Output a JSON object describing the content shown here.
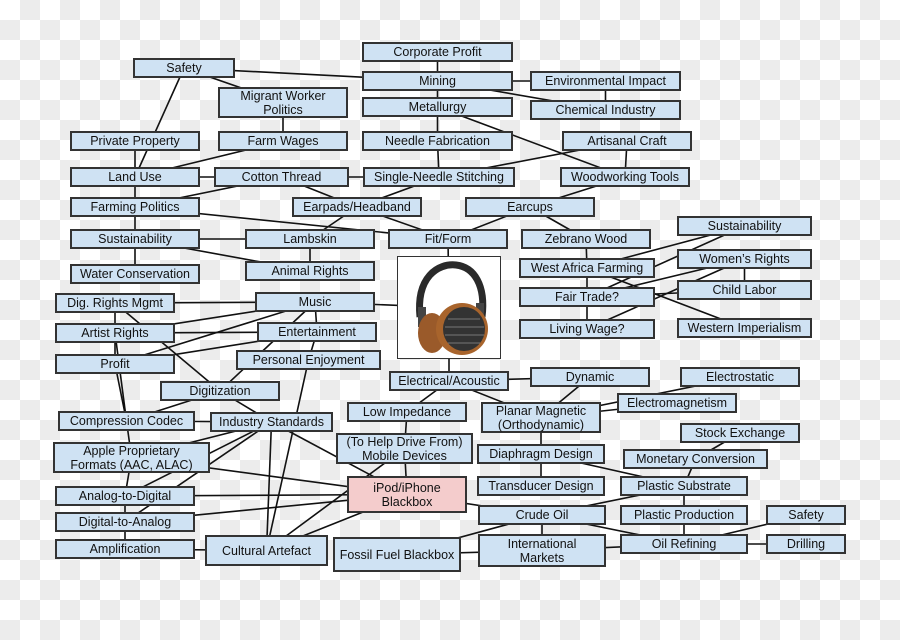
{
  "nodes": {
    "corp_profit": "Corporate Profit",
    "safety1": "Safety",
    "mining": "Mining",
    "env_impact": "Environmental Impact",
    "migrant": "Migrant Worker\nPolitics",
    "metallurgy": "Metallurgy",
    "chemical": "Chemical Industry",
    "private_prop": "Private Property",
    "farm_wages": "Farm Wages",
    "needle_fab": "Needle Fabrication",
    "artisanal": "Artisanal Craft",
    "land_use": "Land Use",
    "cotton": "Cotton Thread",
    "single_needle": "Single-Needle Stitching",
    "woodworking": "Woodworking Tools",
    "farming_pol": "Farming Politics",
    "earpads": "Earpads/Headband",
    "earcups": "Earcups",
    "sustain1": "Sustainability",
    "lambskin": "Lambskin",
    "fitform": "Fit/Form",
    "zebrano": "Zebrano Wood",
    "sustain2": "Sustainability",
    "water": "Water Conservation",
    "animal": "Animal Rights",
    "west_africa": "West Africa Farming",
    "womens": "Women’s Rights",
    "fair_trade": "Fair Trade?",
    "child_labor": "Child Labor",
    "drm": "Dig. Rights Mgmt",
    "music": "Music",
    "artist": "Artist Rights",
    "entertain": "Entertainment",
    "living_wage": "Living Wage?",
    "western": "Western Imperialism",
    "profit": "Profit",
    "personal": "Personal Enjoyment",
    "electrical": "Electrical/Acoustic",
    "dynamic": "Dynamic",
    "electrostatic": "Electrostatic",
    "digitization": "Digitization",
    "electromag": "Electromagnetism",
    "low_imp": "Low Impedance",
    "planar": "Planar Magnetic\n(Orthodynamic)",
    "compression": "Compression Codec",
    "industry": "Industry Standards",
    "stock": "Stock Exchange",
    "apple": "Apple Proprietary\nFormats (AAC, ALAC)",
    "mobile": "(To Help Drive From)\nMobile Devices",
    "diaphragm": "Diaphragm Design",
    "monetary": "Monetary Conversion",
    "ipod": "iPod/iPhone\nBlackbox",
    "transducer": "Transducer Design",
    "plastic_sub": "Plastic Substrate",
    "analog_dig": "Analog-to-Digital",
    "crude": "Crude Oil",
    "plastic_prod": "Plastic Production",
    "safety2": "Safety",
    "dig_analog": "Digital-to-Analog",
    "amplification": "Amplification",
    "cultural": "Cultural Artefact",
    "fossil": "Fossil Fuel Blackbox",
    "intl": "International\nMarkets",
    "oil_ref": "Oil Refining",
    "drilling": "Drilling"
  },
  "highlighted": [
    "ipod"
  ],
  "center_image": "headphones-photo",
  "colors": {
    "node_fill": "#cfe2f3",
    "highlight_fill": "#f4cccc",
    "border": "#333333"
  },
  "edges": [
    [
      "corp_profit",
      "mining"
    ],
    [
      "safety1",
      "mining"
    ],
    [
      "safety1",
      "migrant"
    ],
    [
      "safety1",
      "land_use"
    ],
    [
      "mining",
      "metallurgy"
    ],
    [
      "mining",
      "env_impact"
    ],
    [
      "mining",
      "chemical"
    ],
    [
      "env_impact",
      "chemical"
    ],
    [
      "metallurgy",
      "needle_fab"
    ],
    [
      "metallurgy",
      "woodworking"
    ],
    [
      "migrant",
      "farm_wages"
    ],
    [
      "farm_wages",
      "land_use"
    ],
    [
      "private_prop",
      "land_use"
    ],
    [
      "land_use",
      "farming_pol"
    ],
    [
      "cotton",
      "farming_pol"
    ],
    [
      "cotton",
      "land_use"
    ],
    [
      "needle_fab",
      "single_needle"
    ],
    [
      "artisanal",
      "single_needle"
    ],
    [
      "cotton",
      "single_needle"
    ],
    [
      "artisanal",
      "woodworking"
    ],
    [
      "cotton",
      "earpads"
    ],
    [
      "single_needle",
      "earpads"
    ],
    [
      "woodworking",
      "earcups"
    ],
    [
      "earpads",
      "fitform"
    ],
    [
      "earcups",
      "fitform"
    ],
    [
      "earcups",
      "zebrano"
    ],
    [
      "earpads",
      "lambskin"
    ],
    [
      "farming_pol",
      "fitform"
    ],
    [
      "farming_pol",
      "sustain1"
    ],
    [
      "sustain1",
      "water"
    ],
    [
      "sustain1",
      "lambskin"
    ],
    [
      "sustain1",
      "animal"
    ],
    [
      "lambskin",
      "animal"
    ],
    [
      "fitform",
      "photo"
    ],
    [
      "photo",
      "music"
    ],
    [
      "photo",
      "electrical"
    ],
    [
      "zebrano",
      "west_africa"
    ],
    [
      "west_africa",
      "fair_trade"
    ],
    [
      "fair_trade",
      "living_wage"
    ],
    [
      "west_africa",
      "sustain2"
    ],
    [
      "west_africa",
      "western"
    ],
    [
      "fair_trade",
      "sustain2"
    ],
    [
      "fair_trade",
      "womens"
    ],
    [
      "fair_trade",
      "child_labor"
    ],
    [
      "living_wage",
      "womens"
    ],
    [
      "womens",
      "child_labor"
    ],
    [
      "drm",
      "music"
    ],
    [
      "drm",
      "artist"
    ],
    [
      "drm",
      "digitization"
    ],
    [
      "artist",
      "music"
    ],
    [
      "artist",
      "entertain"
    ],
    [
      "artist",
      "profit"
    ],
    [
      "profit",
      "music"
    ],
    [
      "profit",
      "entertain"
    ],
    [
      "music",
      "entertain"
    ],
    [
      "music",
      "digitization"
    ],
    [
      "entertain",
      "personal"
    ],
    [
      "personal",
      "cultural"
    ],
    [
      "profit",
      "compression"
    ],
    [
      "artist",
      "compression"
    ],
    [
      "digitization",
      "compression"
    ],
    [
      "digitization",
      "industry"
    ],
    [
      "compression",
      "industry"
    ],
    [
      "compression",
      "apple"
    ],
    [
      "industry",
      "apple"
    ],
    [
      "industry",
      "analog_dig"
    ],
    [
      "industry",
      "dig_analog"
    ],
    [
      "industry",
      "cultural"
    ],
    [
      "industry",
      "ipod"
    ],
    [
      "apple",
      "ipod"
    ],
    [
      "apple",
      "analog_dig"
    ],
    [
      "analog_dig",
      "dig_analog"
    ],
    [
      "dig_analog",
      "amplification"
    ],
    [
      "analog_dig",
      "ipod"
    ],
    [
      "dig_analog",
      "ipod"
    ],
    [
      "amplification",
      "cultural"
    ],
    [
      "cultural",
      "ipod"
    ],
    [
      "cultural",
      "mobile"
    ],
    [
      "mobile",
      "low_imp"
    ],
    [
      "mobile",
      "ipod"
    ],
    [
      "low_imp",
      "electrical"
    ],
    [
      "electrical",
      "dynamic"
    ],
    [
      "electrical",
      "planar"
    ],
    [
      "dynamic",
      "planar"
    ],
    [
      "electrostatic",
      "planar"
    ],
    [
      "electromag",
      "planar"
    ],
    [
      "planar",
      "diaphragm"
    ],
    [
      "diaphragm",
      "transducer"
    ],
    [
      "diaphragm",
      "plastic_sub"
    ],
    [
      "stock",
      "monetary"
    ],
    [
      "monetary",
      "plastic_sub"
    ],
    [
      "plastic_sub",
      "crude"
    ],
    [
      "plastic_sub",
      "plastic_prod"
    ],
    [
      "plastic_prod",
      "oil_ref"
    ],
    [
      "crude",
      "intl"
    ],
    [
      "crude",
      "oil_ref"
    ],
    [
      "ipod",
      "crude"
    ],
    [
      "fossil",
      "crude"
    ],
    [
      "fossil",
      "intl"
    ],
    [
      "intl",
      "oil_ref"
    ],
    [
      "oil_ref",
      "safety2"
    ],
    [
      "oil_ref",
      "drilling"
    ]
  ]
}
